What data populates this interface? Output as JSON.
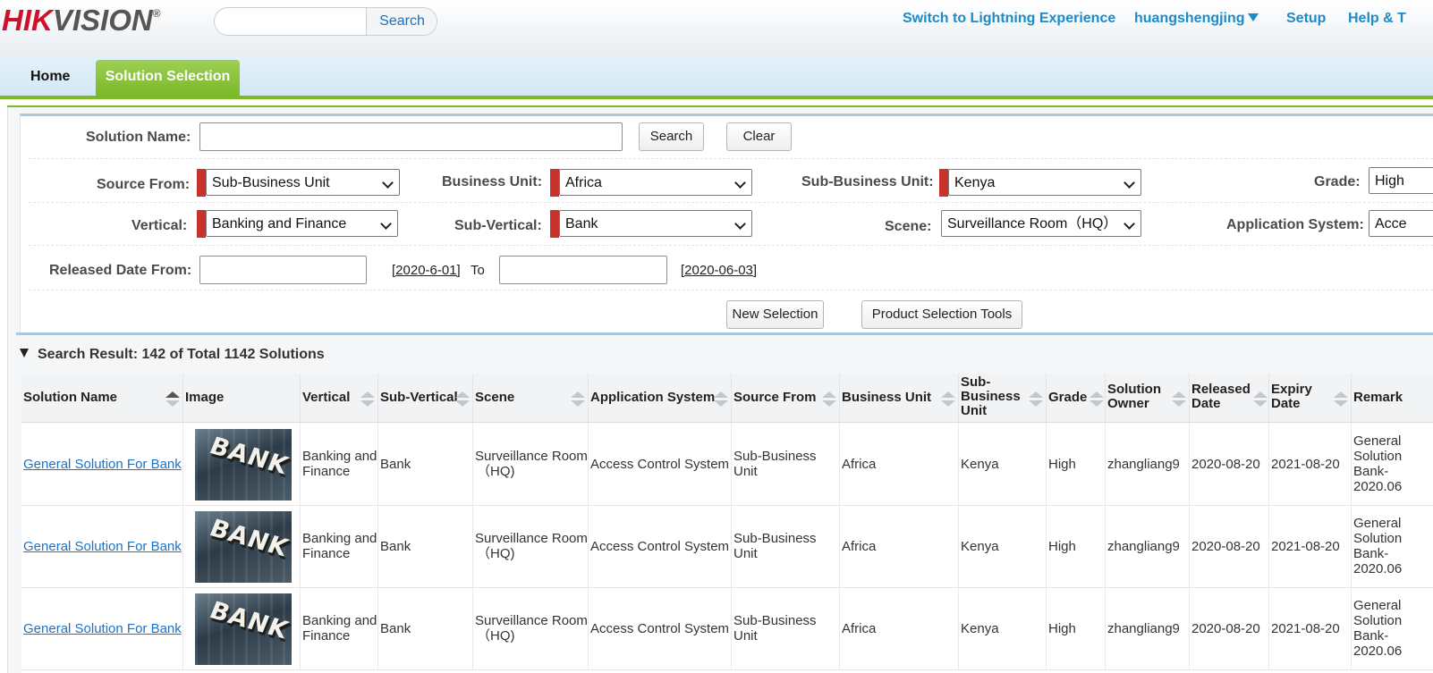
{
  "brand": {
    "logo_hik": "HIK",
    "logo_vision": "VISION",
    "logo_reg": "®"
  },
  "header": {
    "search_button": "Search",
    "search_value": "",
    "links": {
      "lightning": "Switch to Lightning Experience",
      "user": "huangshengjing",
      "setup": "Setup",
      "help": "Help & T"
    }
  },
  "tabs": {
    "home": "Home",
    "active": "Solution Selection"
  },
  "filters": {
    "solution_name_label": "Solution Name:",
    "solution_name_value": "",
    "search_button": "Search",
    "clear_button": "Clear",
    "source_from_label": "Source From:",
    "source_from_value": "Sub-Business Unit",
    "business_unit_label": "Business Unit:",
    "business_unit_value": "Africa",
    "sub_business_unit_label": "Sub-Business Unit:",
    "sub_business_unit_value": "Kenya",
    "grade_label": "Grade:",
    "grade_value": "High",
    "vertical_label": "Vertical:",
    "vertical_value": "Banking and Finance",
    "sub_vertical_label": "Sub-Vertical:",
    "sub_vertical_value": "Bank",
    "scene_label": "Scene:",
    "scene_value": "Surveillance Room（HQ）",
    "application_system_label": "Application System:",
    "application_system_value": "Acce",
    "released_from_label": "Released Date From:",
    "released_from_value": "",
    "date_from_link": "[2020-6-01]",
    "to_label": "To",
    "released_to_value": "",
    "date_to_link": "[2020-06-03]",
    "new_selection_button": "New Selection",
    "product_tools_button": "Product Selection Tools"
  },
  "results": {
    "title": "Search Result: 142 of Total 1142 Solutions",
    "columns": [
      "Solution Name",
      "Image",
      "Vertical",
      "Sub-Vertical",
      "Scene",
      "Application System",
      "Source From",
      "Business Unit",
      "Sub-Business Unit",
      "Grade",
      "Solution Owner",
      "Released Date",
      "Expiry Date",
      "Remark"
    ],
    "column_lines": {
      "sub_business_unit": [
        "Sub-",
        "Business",
        "Unit"
      ],
      "solution_owner": [
        "Solution",
        "Owner"
      ],
      "released_date": [
        "Released",
        "Date"
      ],
      "expiry_date": [
        "Expiry",
        "Date"
      ]
    },
    "image_text": "BANK",
    "rows": [
      {
        "name": "General Solution For Bank",
        "vertical": [
          "Banking and",
          "Finance"
        ],
        "sub_vertical": "Bank",
        "scene": [
          "Surveillance Room",
          "（HQ)"
        ],
        "application": "Access Control System",
        "source": [
          "Sub-Business",
          "Unit"
        ],
        "business_unit": "Africa",
        "sub_business_unit": "Kenya",
        "grade": "High",
        "owner": "zhangliang9",
        "released": "2020-08-20",
        "expiry": "2021-08-20",
        "remark": [
          "General",
          "Solution",
          "Bank-",
          "2020.06"
        ]
      },
      {
        "name": "General Solution For Bank",
        "vertical": [
          "Banking and",
          "Finance"
        ],
        "sub_vertical": "Bank",
        "scene": [
          "Surveillance Room",
          "（HQ)"
        ],
        "application": "Access Control System",
        "source": [
          "Sub-Business",
          "Unit"
        ],
        "business_unit": "Africa",
        "sub_business_unit": "Kenya",
        "grade": "High",
        "owner": "zhangliang9",
        "released": "2020-08-20",
        "expiry": "2021-08-20",
        "remark": [
          "General",
          "Solution",
          "Bank-",
          "2020.06"
        ]
      },
      {
        "name": "General Solution For Bank",
        "vertical": [
          "Banking and",
          "Finance"
        ],
        "sub_vertical": "Bank",
        "scene": [
          "Surveillance Room",
          "（HQ)"
        ],
        "application": "Access Control System",
        "source": [
          "Sub-Business",
          "Unit"
        ],
        "business_unit": "Africa",
        "sub_business_unit": "Kenya",
        "grade": "High",
        "owner": "zhangliang9",
        "released": "2020-08-20",
        "expiry": "2021-08-20",
        "remark": [
          "General",
          "Solution",
          "Bank-",
          "2020.06"
        ]
      }
    ]
  },
  "colors": {
    "brand_red": "#d0112b",
    "link_blue": "#1b8bc9",
    "tab_green": "#7bb82a",
    "required_red": "#c9312b"
  }
}
